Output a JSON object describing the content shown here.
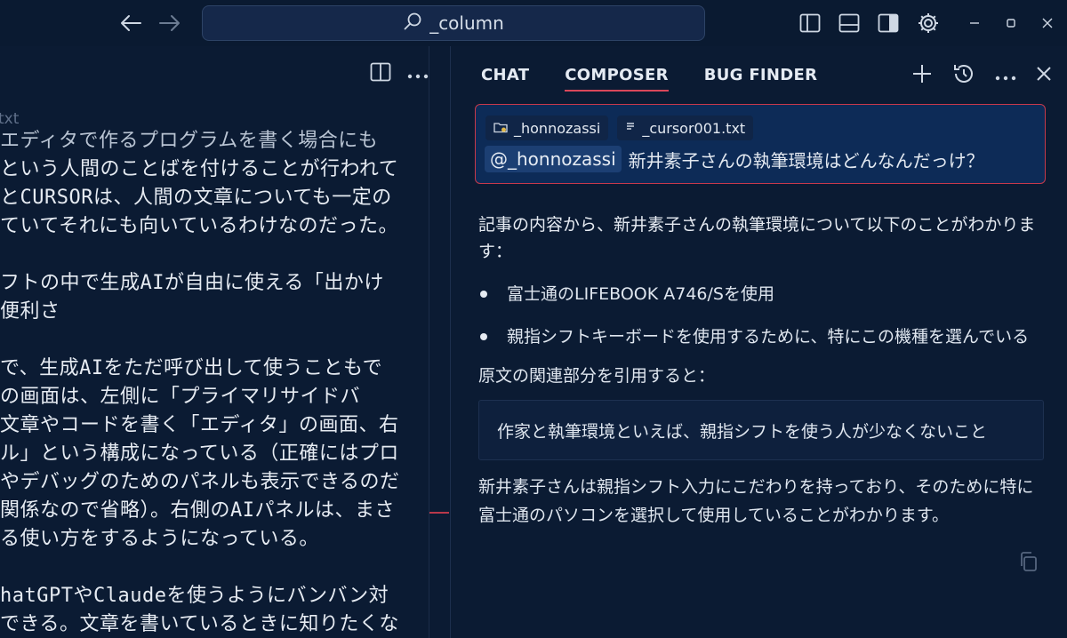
{
  "titlebar": {
    "search_text": "_column",
    "icons": [
      "back-arrow-icon",
      "forward-arrow-icon",
      "search-icon",
      "toggle-primary-sidebar-icon",
      "toggle-panel-icon",
      "toggle-secondary-sidebar-icon",
      "gear-icon",
      "minimize-icon",
      "maximize-icon",
      "close-icon"
    ]
  },
  "editor": {
    "tab_fragment": "txt",
    "lines": [
      "エディタで作るプログラムを書く場合にも",
      "という人間のことばを付けることが行われて",
      "とCURSORは、人間の文章についても一定の",
      "ていてそれにも向いているわけなのだった。",
      "",
      "フトの中で生成AIが自由に使える「出かけ",
      "便利さ",
      "",
      "で、生成AIをただ呼び出して使うこともで",
      "の画面は、左側に「プライマリサイドバ",
      "文章やコードを書く「エディタ」の画面、右",
      "ル」という構成になっている（正確にはプロ",
      "やデバッグのためのパネルも表示できるのだ",
      "関係なので省略）。右側のAIパネルは、まさ",
      "る使い方をするようになっている。",
      "",
      "hatGPTやClaudeを使うようにバンバン対",
      "できる。文章を書いているときに知りたくな"
    ]
  },
  "panel": {
    "tabs": [
      {
        "label": "CHAT",
        "active": false
      },
      {
        "label": "COMPOSER",
        "active": true
      },
      {
        "label": "BUG FINDER",
        "active": false
      }
    ],
    "composer": {
      "chips": [
        "_honnozassi",
        "_cursor001.txt"
      ],
      "mention": "@_honnozassi",
      "query": "新井素子さんの執筆環境はどんなんだっけ？"
    },
    "answer": {
      "intro": "記事の内容から、新井素子さんの執筆環境について以下のことがわかります：",
      "bullets": [
        "富士通のLIFEBOOK A746/Sを使用",
        "親指シフトキーボードを使用するために、特にこの機種を選んでいる"
      ],
      "quote_intro": "原文の関連部分を引用すると：",
      "quote": "作家と執筆環境といえば、親指シフトを使う人が少なくないこと",
      "conclusion": "新井素子さんは親指シフト入力にこだわりを持っており、そのために特に富士通のパソコンを選択して使用していることがわかります。"
    }
  },
  "colors": {
    "background": "#0b1b33",
    "accent_red": "#c7394b",
    "composer_bg": "#0d2b57"
  }
}
